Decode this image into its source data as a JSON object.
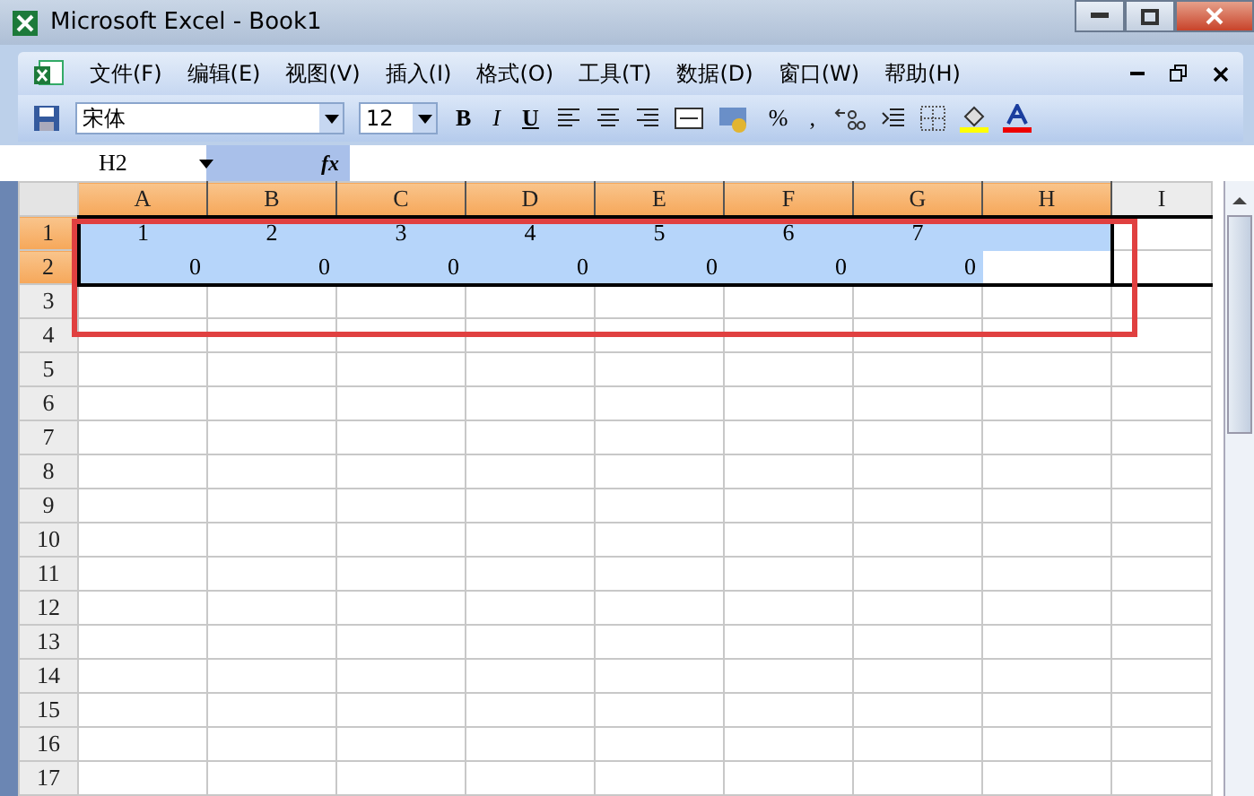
{
  "window": {
    "title": "Microsoft Excel - Book1"
  },
  "menu": [
    {
      "label": "文件(F)"
    },
    {
      "label": "编辑(E)"
    },
    {
      "label": "视图(V)"
    },
    {
      "label": "插入(I)"
    },
    {
      "label": "格式(O)"
    },
    {
      "label": "工具(T)"
    },
    {
      "label": "数据(D)"
    },
    {
      "label": "窗口(W)"
    },
    {
      "label": "帮助(H)"
    }
  ],
  "toolbar": {
    "font": "宋体",
    "size": "12",
    "bold": "B",
    "italic": "I",
    "underline": "U",
    "percent": "%",
    "comma": ","
  },
  "formula_bar": {
    "name_box": "H2",
    "fx": "fx"
  },
  "columns": [
    {
      "label": "A",
      "selected": true
    },
    {
      "label": "B",
      "selected": true
    },
    {
      "label": "C",
      "selected": true
    },
    {
      "label": "D",
      "selected": true
    },
    {
      "label": "E",
      "selected": true
    },
    {
      "label": "F",
      "selected": true
    },
    {
      "label": "G",
      "selected": true
    },
    {
      "label": "H",
      "selected": true
    },
    {
      "label": "I",
      "selected": false
    }
  ],
  "rows": [
    {
      "label": "1",
      "selected": true,
      "cells": [
        {
          "kind": "centered",
          "value": "1"
        },
        {
          "kind": "centered",
          "value": "2"
        },
        {
          "kind": "centered",
          "value": "3"
        },
        {
          "kind": "centered",
          "value": "4"
        },
        {
          "kind": "centered",
          "value": "5"
        },
        {
          "kind": "centered",
          "value": "6"
        },
        {
          "kind": "centered",
          "value": "7"
        }
      ]
    },
    {
      "label": "2",
      "selected": true,
      "cells": [
        {
          "kind": "number",
          "value": "0"
        },
        {
          "kind": "number",
          "value": "0"
        },
        {
          "kind": "number",
          "value": "0"
        },
        {
          "kind": "number",
          "value": "0"
        },
        {
          "kind": "number",
          "value": "0"
        },
        {
          "kind": "number",
          "value": "0"
        },
        {
          "kind": "number",
          "value": "0"
        },
        {
          "active": true
        }
      ]
    },
    {
      "label": "3",
      "selected": false
    },
    {
      "label": "4",
      "selected": false
    },
    {
      "label": "5",
      "selected": false
    },
    {
      "label": "6",
      "selected": false
    },
    {
      "label": "7",
      "selected": false
    },
    {
      "label": "8",
      "selected": false
    },
    {
      "label": "9",
      "selected": false
    },
    {
      "label": "10",
      "selected": false
    },
    {
      "label": "11",
      "selected": false
    },
    {
      "label": "12",
      "selected": false
    },
    {
      "label": "13",
      "selected": false
    },
    {
      "label": "14",
      "selected": false
    },
    {
      "label": "15",
      "selected": false
    },
    {
      "label": "16",
      "selected": false
    },
    {
      "label": "17",
      "selected": false
    }
  ]
}
